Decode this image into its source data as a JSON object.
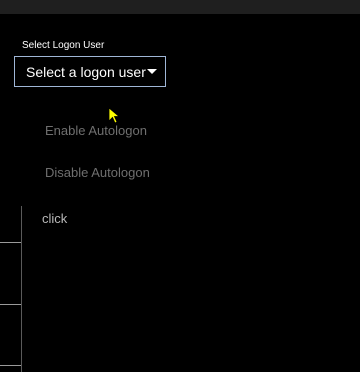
{
  "logon": {
    "label": "Select Logon User",
    "combo_placeholder": "Select a logon user"
  },
  "actions": {
    "enable_label": "Enable Autologon",
    "disable_label": "Disable Autologon"
  },
  "status": {
    "text": "click"
  },
  "icons": {
    "dropdown": "chevron-down-icon",
    "pointer": "mouse-pointer-icon"
  },
  "colors": {
    "background": "#000000",
    "combo_border": "#9fb6d6",
    "disabled_text": "#6f6f6f",
    "cursor": "#ffff00"
  }
}
